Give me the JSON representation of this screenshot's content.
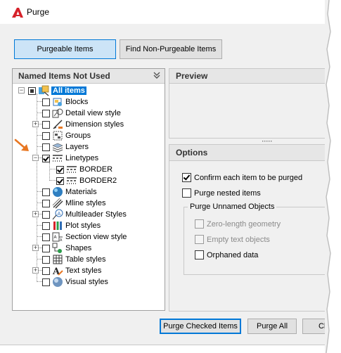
{
  "window": {
    "title": "Purge"
  },
  "tabs": [
    {
      "label": "Purgeable Items",
      "active": true
    },
    {
      "label": "Find Non-Purgeable Items",
      "active": false
    }
  ],
  "left_panel": {
    "title": "Named Items Not Used",
    "tree": [
      {
        "label": "All items",
        "state": "partial",
        "selected": true,
        "icon": "all-items-icon"
      },
      {
        "label": "Blocks",
        "state": "unchecked",
        "icon": "blocks-icon"
      },
      {
        "label": "Detail view style",
        "state": "unchecked",
        "icon": "detail-view-style-icon"
      },
      {
        "label": "Dimension styles",
        "state": "unchecked",
        "icon": "dimension-styles-icon"
      },
      {
        "label": "Groups",
        "state": "unchecked",
        "icon": "groups-icon"
      },
      {
        "label": "Layers",
        "state": "unchecked",
        "icon": "layers-icon"
      },
      {
        "label": "Linetypes",
        "state": "checked",
        "icon": "linetypes-icon"
      },
      {
        "label": "BORDER",
        "state": "checked",
        "icon": "linetype-icon"
      },
      {
        "label": "BORDER2",
        "state": "checked",
        "icon": "linetype-icon"
      },
      {
        "label": "Materials",
        "state": "unchecked",
        "icon": "materials-icon"
      },
      {
        "label": "Mline styles",
        "state": "unchecked",
        "icon": "mline-styles-icon"
      },
      {
        "label": "Multileader Styles",
        "state": "unchecked",
        "icon": "multileader-styles-icon"
      },
      {
        "label": "Plot styles",
        "state": "unchecked",
        "icon": "plot-styles-icon"
      },
      {
        "label": "Section view style",
        "state": "unchecked",
        "icon": "section-view-style-icon"
      },
      {
        "label": "Shapes",
        "state": "unchecked",
        "icon": "shapes-icon"
      },
      {
        "label": "Table styles",
        "state": "unchecked",
        "icon": "table-styles-icon"
      },
      {
        "label": "Text styles",
        "state": "unchecked",
        "icon": "text-styles-icon"
      },
      {
        "label": "Visual styles",
        "state": "unchecked",
        "icon": "visual-styles-icon"
      }
    ]
  },
  "preview": {
    "title": "Preview"
  },
  "options": {
    "title": "Options",
    "confirm_each": {
      "label": "Confirm each item to be purged",
      "checked": true
    },
    "purge_nested": {
      "label": "Purge nested items",
      "checked": false
    },
    "unnamed_group": "Purge Unnamed Objects",
    "zero_length": {
      "label": "Zero-length geometry",
      "checked": false,
      "enabled": false
    },
    "empty_text": {
      "label": "Empty text objects",
      "checked": false,
      "enabled": false
    },
    "orphaned_data": {
      "label": "Orphaned data",
      "checked": false,
      "enabled": true
    }
  },
  "buttons": {
    "purge_checked": "Purge Checked Items",
    "purge_all": "Purge All",
    "close": "Close"
  },
  "colors": {
    "accent": "#0078d7",
    "selected_tab": "#cce4f7",
    "callout_arrow": "#e87722"
  }
}
